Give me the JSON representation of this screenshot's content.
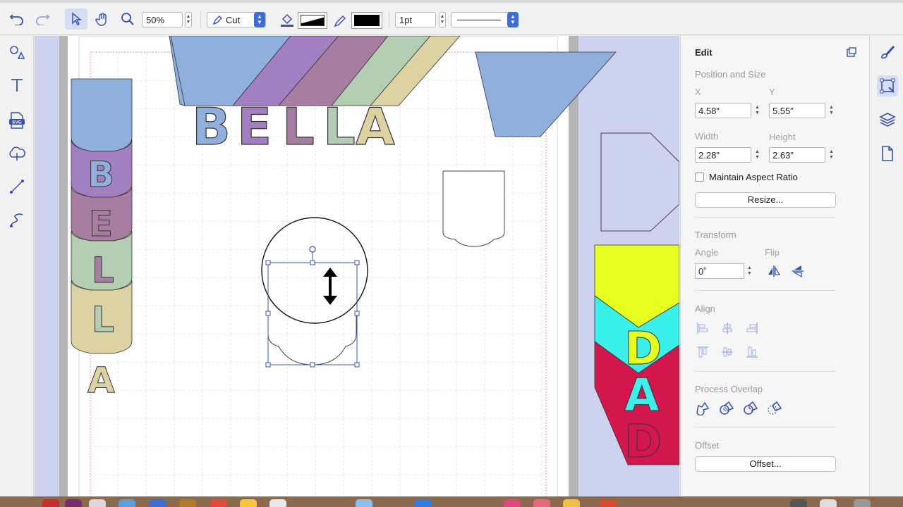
{
  "toolbar": {
    "zoom_value": "50%",
    "operation_value": "Cut",
    "stroke_width_value": "1pt",
    "colors": {
      "fill": "#000000",
      "stroke": "#000000",
      "accent": "#3550b5"
    }
  },
  "left_tools": [
    "shapes-icon",
    "text-icon",
    "svg-icon",
    "cloud-icon",
    "line-icon",
    "pen-icon"
  ],
  "canvas": {
    "texts": {
      "bella_horizontal": [
        "B",
        "E",
        "L",
        "L",
        "A"
      ],
      "bella_vertical": [
        "B",
        "E",
        "L",
        "L",
        "A"
      ],
      "dad_vertical": [
        "D",
        "A",
        "D"
      ]
    },
    "colors": {
      "blue": "#8fb0dc",
      "purple": "#a27fc0",
      "mauve": "#a77ea2",
      "sage": "#b4ceb4",
      "tan": "#ddd3a2",
      "yellow": "#e6ff1f",
      "cyan": "#3af0ea",
      "crimson": "#d3174c"
    }
  },
  "panel": {
    "title": "Edit",
    "position_size": {
      "heading": "Position and Size",
      "x_label": "X",
      "x_value": "4.58\"",
      "y_label": "Y",
      "y_value": "5.55\"",
      "width_label": "Width",
      "width_value": "2.28\"",
      "height_label": "Height",
      "height_value": "2.63\"",
      "aspect_label": "Maintain Aspect Ratio",
      "aspect_checked": false,
      "resize_label": "Resize..."
    },
    "transform": {
      "heading": "Transform",
      "angle_label": "Angle",
      "angle_value": "0˚",
      "flip_label": "Flip"
    },
    "align": {
      "heading": "Align"
    },
    "process_overlap": {
      "heading": "Process Overlap"
    },
    "offset": {
      "heading": "Offset",
      "button_label": "Offset..."
    }
  },
  "right_tools": [
    "brush-icon",
    "edit-icon",
    "layers-icon",
    "document-icon"
  ]
}
